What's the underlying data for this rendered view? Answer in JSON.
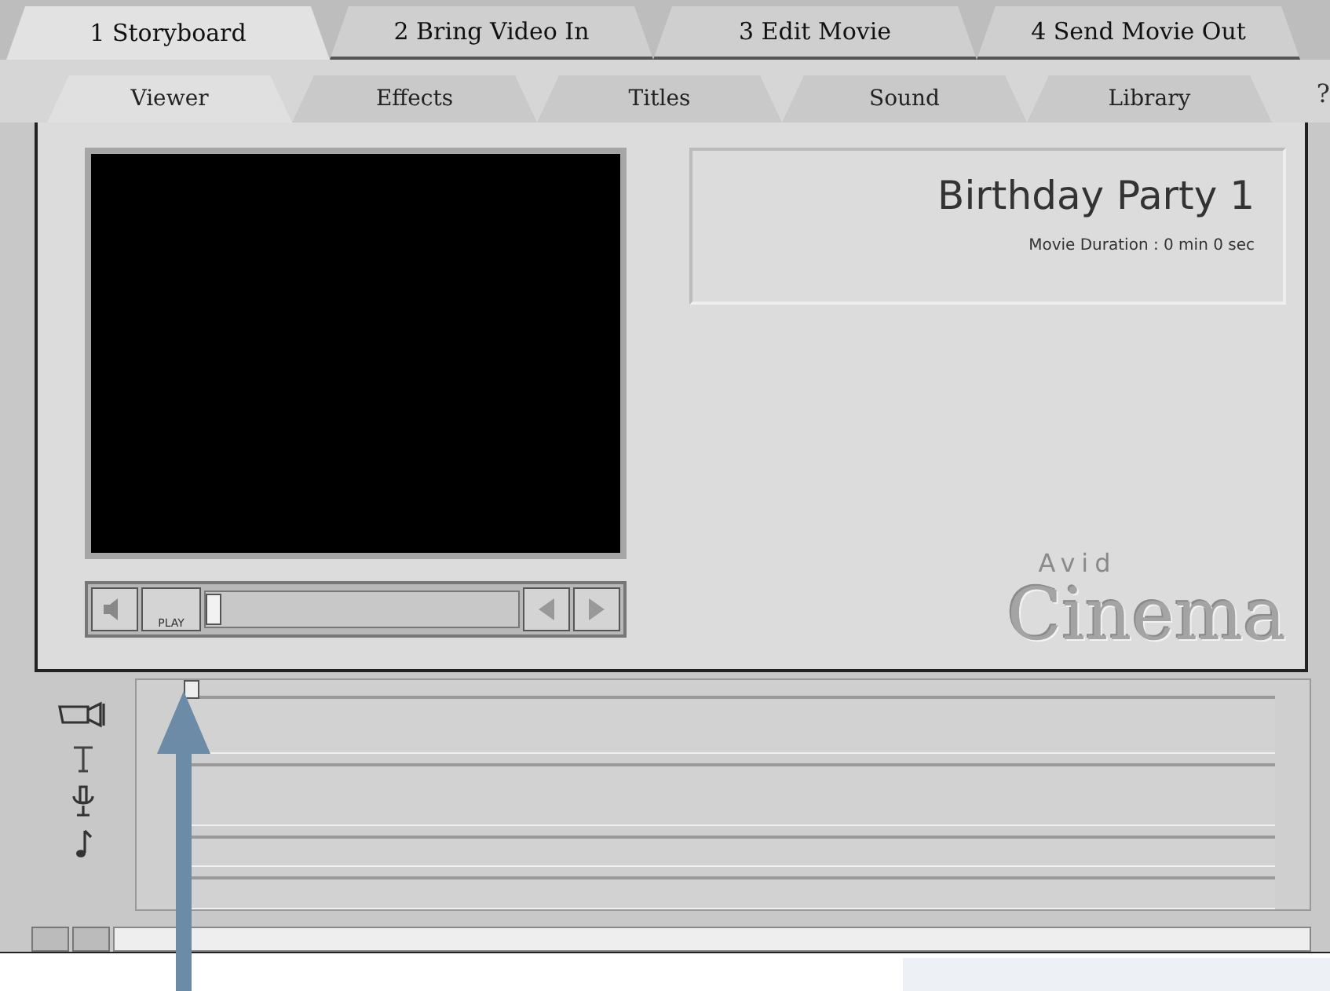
{
  "steps": [
    {
      "label": "1 Storyboard",
      "selected": true
    },
    {
      "label": "2 Bring Video In",
      "selected": false
    },
    {
      "label": "3 Edit Movie",
      "selected": false
    },
    {
      "label": "4 Send Movie Out",
      "selected": false
    }
  ],
  "tabs": [
    {
      "label": "Viewer",
      "selected": true
    },
    {
      "label": "Effects",
      "selected": false
    },
    {
      "label": "Titles",
      "selected": false
    },
    {
      "label": "Sound",
      "selected": false
    },
    {
      "label": "Library",
      "selected": false
    }
  ],
  "help": "?",
  "viewer": {
    "play_label": "PLAY",
    "scrub": {
      "level": 0
    }
  },
  "project": {
    "title": "Birthday Party 1",
    "duration": "Movie Duration : 0 min 0 sec"
  },
  "logo": {
    "small": "Avid",
    "large": "Cinema"
  },
  "timeline": {
    "playhead": {
      "level": 0
    },
    "tracks": [
      {
        "kind": "video"
      },
      {
        "kind": "title"
      },
      {
        "kind": "voice"
      },
      {
        "kind": "music"
      }
    ]
  }
}
